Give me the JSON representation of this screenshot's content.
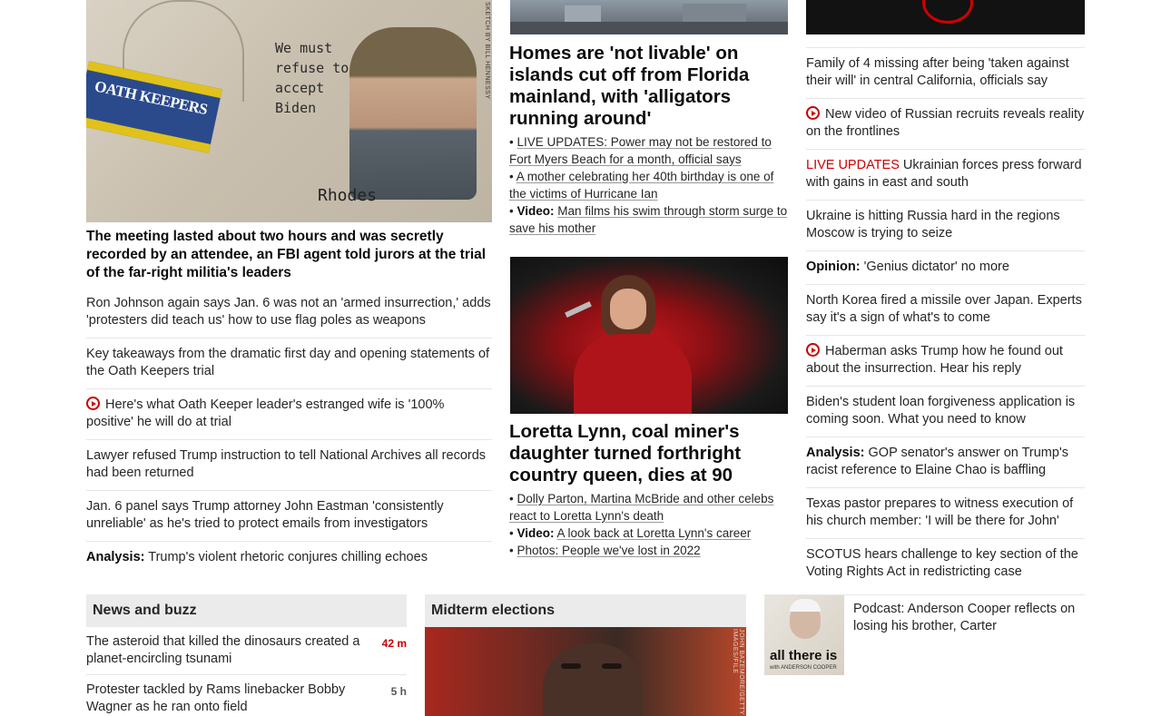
{
  "left_column": {
    "image_caption_lines": [
      "We must",
      "refuse to",
      "accept",
      "Biden"
    ],
    "image_flag": "OATH KEEPERS",
    "image_name": "Rhodes",
    "image_credit": "SKETCH BY BILL HENNESSY",
    "headline": "The meeting lasted about two hours and was secretly recorded by an attendee, an FBI agent told jurors at the trial of the far-right militia's leaders",
    "items": [
      {
        "text": "Ron Johnson again says Jan. 6 was not an 'armed insurrection,' adds 'protesters did teach us' how to use flag poles as weapons"
      },
      {
        "text": "Key takeaways from the dramatic first day and opening statements of the Oath Keepers trial"
      },
      {
        "video": true,
        "text": "Here's what Oath Keeper leader's estranged wife is '100% positive' he will do at trial"
      },
      {
        "text": "Lawyer refused Trump instruction to tell National Archives all records had been returned"
      },
      {
        "text": "Jan. 6 panel says Trump attorney John Eastman 'consistently unreliable' as he's tried to protect emails from investigators"
      },
      {
        "prefix": "Analysis:",
        "text": "Trump's violent rhetoric conjures chilling echoes"
      }
    ]
  },
  "middle_column": {
    "story1": {
      "headline": "Homes are 'not livable' on islands cut off from Florida mainland, with 'alligators running around'",
      "bullets": [
        {
          "text": "LIVE UPDATES: Power may not be restored to Fort Myers Beach for a month, official says"
        },
        {
          "text": "A mother celebrating her 40th birthday is one of the victims of Hurricane Ian"
        },
        {
          "prefix": "Video:",
          "text": "Man films his swim through storm surge to save his mother"
        }
      ]
    },
    "story2": {
      "headline": "Loretta Lynn, coal miner's daughter turned forthright country queen, dies at 90",
      "bullets": [
        {
          "text": "Dolly Parton, Martina McBride and other celebs react to Loretta Lynn's death"
        },
        {
          "prefix": "Video:",
          "text": "A look back at Loretta Lynn's career"
        },
        {
          "text": "Photos: People we've lost in 2022"
        }
      ]
    }
  },
  "right_column": {
    "items": [
      {
        "text": "Family of 4 missing after being 'taken against their will' in central California, officials say"
      },
      {
        "video": true,
        "text": "New video of Russian recruits reveals reality on the frontlines"
      },
      {
        "live": "LIVE UPDATES",
        "text": "Ukrainian forces press forward with gains in east and south"
      },
      {
        "text": "Ukraine is hitting Russia hard in the regions Moscow is trying to seize"
      },
      {
        "prefix": "Opinion:",
        "text": "'Genius dictator' no more"
      },
      {
        "text": "North Korea fired a missile over Japan. Experts say it's a sign of what's to come"
      },
      {
        "video": true,
        "text": "Haberman asks Trump how he found out about the insurrection. Hear his reply"
      },
      {
        "text": "Biden's student loan forgiveness application is coming soon. What you need to know"
      },
      {
        "prefix": "Analysis:",
        "text": "GOP senator's answer on Trump's racist reference to Elaine Chao is baffling"
      },
      {
        "text": "Texas pastor prepares to witness execution of his church member: 'I will be there for John'"
      },
      {
        "text": "SCOTUS hears challenge to key section of the Voting Rights Act in redistricting case"
      }
    ]
  },
  "news_and_buzz": {
    "title": "News and buzz",
    "items": [
      {
        "text": "The asteroid that killed the dinosaurs created a planet-encircling tsunami",
        "time": "42 m",
        "time_color": "#cc0000"
      },
      {
        "text": "Protester tackled by Rams linebacker Bobby Wagner as he ran onto field",
        "time": "5 h",
        "time_color": "#595959"
      }
    ]
  },
  "midterms": {
    "title": "Midterm elections",
    "image_credit": "JOHN BAZEMORE/GETTY IMAGES/FILE"
  },
  "podcast": {
    "text": "Podcast: Anderson Cooper reflects on losing his brother, Carter",
    "art_title": "all there is",
    "art_subtitle": "with ANDERSON COOPER"
  },
  "colors": {
    "accent": "#cc0000",
    "divider": "#e6e6e6",
    "section_bg": "#ebebeb"
  }
}
